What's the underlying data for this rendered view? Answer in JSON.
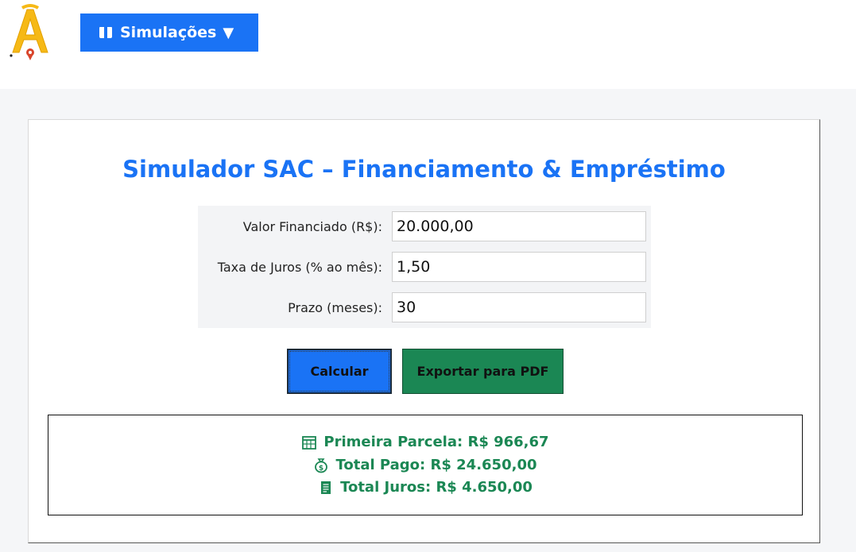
{
  "nav": {
    "logo_letter": "A",
    "menu_label": "Simulações",
    "menu_caret": "▼",
    "menu_icon": "box-icon"
  },
  "main": {
    "title": "Simulador SAC – Financiamento & Empréstimo",
    "form": {
      "fields": [
        {
          "label": "Valor Financiado (R$):",
          "value": "20.000,00"
        },
        {
          "label": "Taxa de Juros (% ao mês):",
          "value": "1,50"
        },
        {
          "label": "Prazo (meses):",
          "value": "30"
        }
      ]
    },
    "buttons": {
      "calculate_label": "Calcular",
      "export_label": "Exportar para PDF"
    },
    "results": [
      {
        "icon": "calendar-icon",
        "text": "Primeira Parcela: R$ 966,67"
      },
      {
        "icon": "money-bag-icon",
        "text": "Total Pago: R$ 24.650,00"
      },
      {
        "icon": "receipt-icon",
        "text": "Total Juros: R$ 4.650,00"
      }
    ]
  },
  "colors": {
    "accent_blue": "#1a73f5",
    "accent_green": "#1b8754"
  }
}
